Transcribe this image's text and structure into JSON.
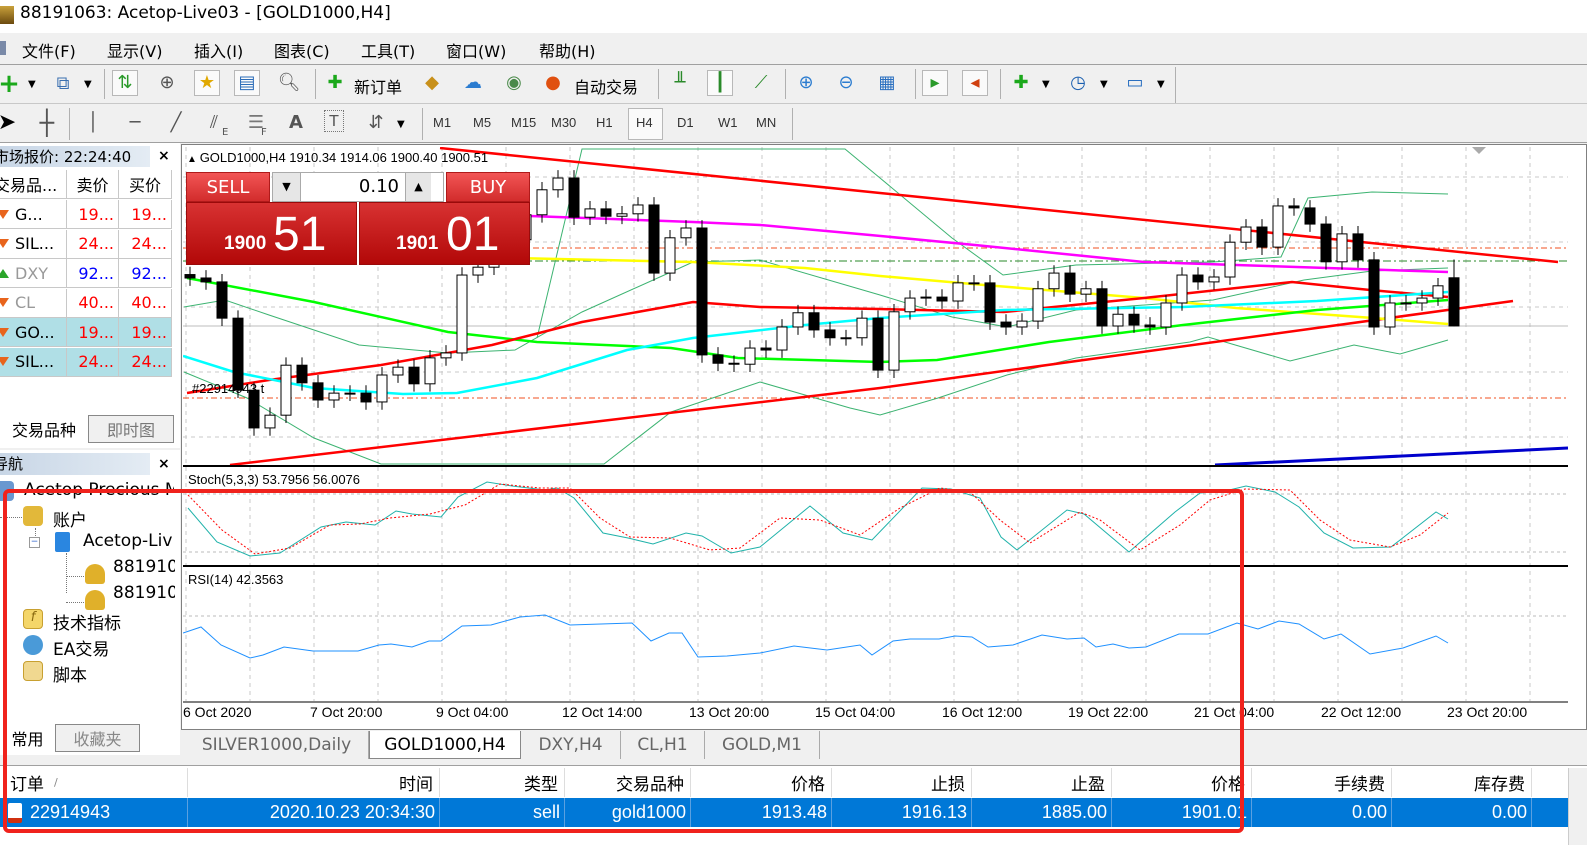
{
  "window": {
    "title": "88191063: Acetop-Live03 - [GOLD1000,H4]"
  },
  "menu": [
    "文件(F)",
    "显示(V)",
    "插入(I)",
    "图表(C)",
    "工具(T)",
    "窗口(W)",
    "帮助(H)"
  ],
  "toolbar": {
    "new_order": "新订单",
    "auto_trading": "自动交易"
  },
  "drawing_toolbar": {
    "fibo_suffix": "E",
    "grid_suffix": "F",
    "text_label": "A",
    "text_box": "T"
  },
  "timeframes": [
    "M1",
    "M5",
    "M15",
    "M30",
    "H1",
    "H4",
    "D1",
    "W1",
    "MN"
  ],
  "active_timeframe": "H4",
  "market_watch": {
    "title": "市场报价: 22:24:40",
    "close": "×",
    "columns": [
      "交易品...",
      "卖价",
      "买价"
    ],
    "rows": [
      {
        "symbol": "G...",
        "bid": "19...",
        "ask": "19...",
        "dir": "down",
        "color": "#ff0000"
      },
      {
        "symbol": "SIL...",
        "bid": "24...",
        "ask": "24...",
        "dir": "down",
        "color": "#ff0000"
      },
      {
        "symbol": "DXY",
        "bid": "92...",
        "ask": "92...",
        "dir": "up",
        "color": "#0000ff"
      },
      {
        "symbol": "CL",
        "bid": "40...",
        "ask": "40...",
        "dir": "down",
        "color": "#ff0000"
      },
      {
        "symbol": "GO...",
        "bid": "19...",
        "ask": "19...",
        "dir": "down",
        "color": "#ff0000"
      },
      {
        "symbol": "SIL...",
        "bid": "24...",
        "ask": "24...",
        "dir": "down",
        "color": "#ff0000"
      }
    ],
    "tabs": [
      "交易品种",
      "即时图"
    ]
  },
  "navigator": {
    "title": "导航",
    "close": "×",
    "items": [
      "Acetop Precious M",
      "账户",
      "Acetop-Liv",
      "881910",
      "881910",
      "技术指标",
      "EA交易",
      "脚本"
    ],
    "tabs": [
      "常用",
      "收藏夹"
    ]
  },
  "chart": {
    "header": "GOLD1000,H4  1910.34 1914.06 1900.40 1900.51",
    "order_label": "#22914943 t",
    "one_click": {
      "sell": "SELL",
      "buy": "BUY",
      "volume": "0.10",
      "bid_big": "1900",
      "bid_pips": "51",
      "ask_big": "1901",
      "ask_pips": "01"
    },
    "stoch_label": "Stoch(5,3,3) 53.7956 56.0076",
    "rsi_label": "RSI(14) 42.3563",
    "time_labels": [
      "6 Oct 2020",
      "7 Oct 20:00",
      "9 Oct 04:00",
      "12 Oct 14:00",
      "13 Oct 20:00",
      "15 Oct 04:00",
      "16 Oct 12:00",
      "19 Oct 22:00",
      "21 Oct 04:00",
      "22 Oct 12:00",
      "23 Oct 20:00"
    ],
    "tabs": [
      "SILVER1000,Daily",
      "GOLD1000,H4",
      "DXY,H4",
      "CL,H1",
      "GOLD,M1"
    ],
    "active_tab": "GOLD1000,H4"
  },
  "chart_data": {
    "type": "candlestick",
    "symbol": "GOLD1000",
    "timeframe": "H4",
    "first_open": 1911.0,
    "last_bar": {
      "open": 1910.34,
      "high": 1914.06,
      "low": 1900.4,
      "close": 1900.51
    },
    "closes": [
      1910.3,
      1909.5,
      1902.1,
      1887.4,
      1879.7,
      1882.3,
      1892.5,
      1888.9,
      1885.4,
      1886.8,
      1886.8,
      1885.0,
      1890.5,
      1892.1,
      1888.7,
      1894.0,
      1895.0,
      1910.9,
      1912.5,
      1915.0,
      1918.1,
      1923.2,
      1928.3,
      1930.7,
      1922.7,
      1924.4,
      1922.9,
      1923.4,
      1925.2,
      1911.3,
      1918.5,
      1920.5,
      1894.6,
      1892.9,
      1892.7,
      1896.0,
      1895.6,
      1900.3,
      1903.2,
      1899.7,
      1898.1,
      1898.1,
      1902.1,
      1891.5,
      1903.4,
      1906.2,
      1906.4,
      1905.6,
      1909.3,
      1909.3,
      1901.3,
      1900.3,
      1901.5,
      1908.1,
      1911.3,
      1907.0,
      1908.1,
      1900.5,
      1902.9,
      1900.7,
      1900.3,
      1905.2,
      1910.9,
      1909.5,
      1910.5,
      1917.6,
      1920.7,
      1916.6,
      1925.0,
      1924.6,
      1921.3,
      1913.6,
      1919.3,
      1914.0,
      1900.3,
      1905.2,
      1905.2,
      1906.2,
      1908.7,
      1910.34
    ],
    "order": {
      "id": "22914943",
      "open_price": 1913.48,
      "sl": 1916.13,
      "tp": 1885.0
    },
    "stochastic": {
      "main": 53.7956,
      "signal": 56.0076,
      "levels": [
        80,
        20
      ]
    },
    "rsi": {
      "value": 42.3563
    }
  },
  "terminal": {
    "columns": [
      "订单",
      "时间",
      "类型",
      "交易品种",
      "价格",
      "止损",
      "止盈",
      "价格",
      "手续费",
      "库存费"
    ],
    "sort_marker": "/",
    "rows": [
      {
        "order": "22914943",
        "time": "2020.10.23 20:34:30",
        "type": "sell",
        "symbol": "gold1000",
        "price": "1913.48",
        "sl": "1916.13",
        "tp": "1885.00",
        "current": "1901.01",
        "commission": "0.00",
        "swap": "0.00"
      }
    ]
  },
  "colors": {
    "sell_bg": "#d22c2c",
    "selected_row": "#0078d7",
    "highlight_row": "#b0dfe6",
    "annotation": "#f0221c"
  }
}
